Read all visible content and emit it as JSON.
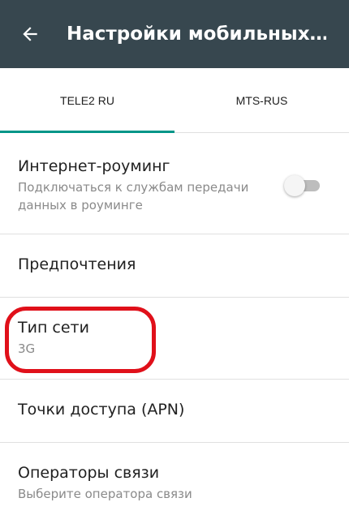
{
  "header": {
    "title": "Настройки мобильных…",
    "back_icon": "arrow-back-icon"
  },
  "tabs": [
    {
      "label": "TELE2 RU",
      "active": true
    },
    {
      "label": "MTS-RUS",
      "active": false
    }
  ],
  "settings": {
    "roaming": {
      "title": "Интернет-роуминг",
      "subtitle": "Подключаться к службам передачи данных в роуминге",
      "toggle_on": false
    },
    "preferences": {
      "title": "Предпочтения"
    },
    "network_type": {
      "title": "Тип сети",
      "value": "3G"
    },
    "apn": {
      "title": "Точки доступа (APN)"
    },
    "operators": {
      "title": "Операторы связи",
      "subtitle": "Выберите оператора связи"
    }
  },
  "colors": {
    "appbar": "#37474f",
    "tab_indicator": "#009688",
    "highlight": "#e0101a"
  }
}
